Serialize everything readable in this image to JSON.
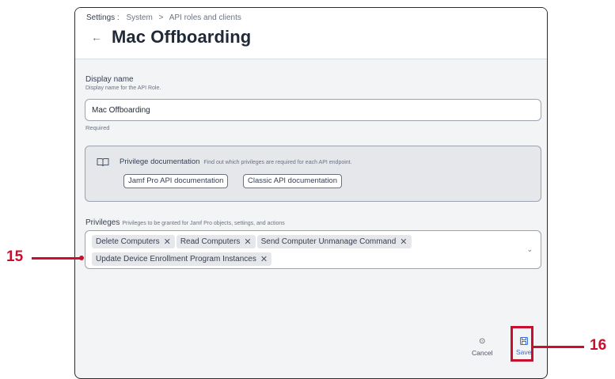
{
  "breadcrumb": {
    "root": "Settings :",
    "items": [
      "System",
      "API roles and clients"
    ],
    "separator": ">"
  },
  "header": {
    "back_icon": "arrow-left-icon",
    "title": "Mac Offboarding"
  },
  "display_name": {
    "label": "Display name",
    "hint": "Display name for the API Role.",
    "value": "Mac Offboarding",
    "required_text": "Required"
  },
  "privilege_docs": {
    "icon": "book-icon",
    "title": "Privilege documentation",
    "subtitle": "Find out which privileges are required for each API endpoint.",
    "buttons": [
      "Jamf Pro API documentation",
      "Classic API documentation"
    ]
  },
  "privileges": {
    "label": "Privileges",
    "subtitle": "Privileges to be granted for Jamf Pro objects, settings, and actions",
    "chips": [
      "Delete Computers",
      "Read Computers",
      "Send Computer Unmanage Command",
      "Update Device Enrollment Program Instances"
    ],
    "remove_glyph": "✕",
    "dropdown_icon": "chevron-down-icon"
  },
  "actions": {
    "cancel": {
      "label": "Cancel",
      "icon": "cancel-circle-icon"
    },
    "save": {
      "label": "Save",
      "icon": "save-icon"
    }
  },
  "callouts": {
    "left": "15",
    "right": "16"
  },
  "colors": {
    "accent": "#3b6ce0",
    "callout": "#c8102e",
    "panel": "#f3f4f6"
  }
}
